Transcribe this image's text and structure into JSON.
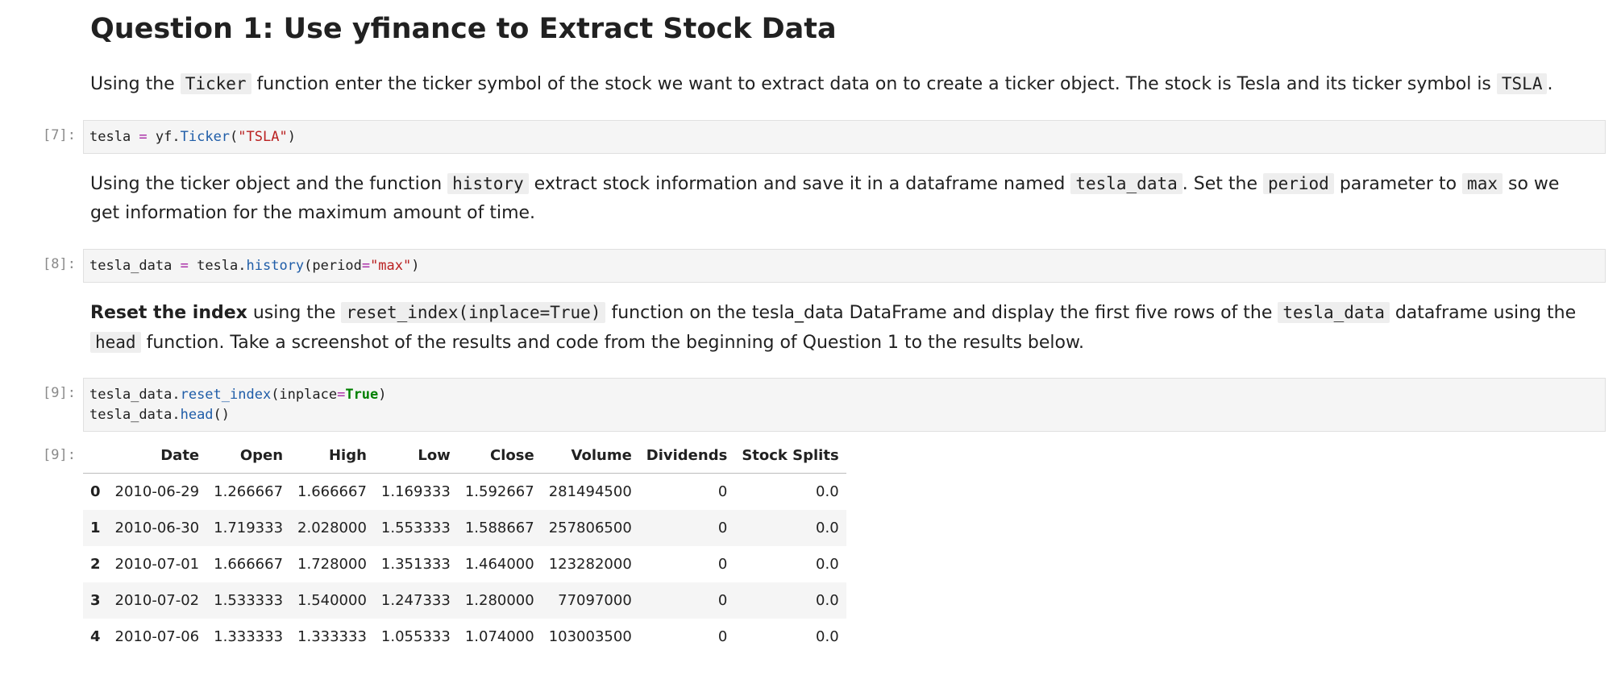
{
  "heading": "Question 1: Use yfinance to Extract Stock Data",
  "para1": {
    "t1": "Using the ",
    "c1": "Ticker",
    "t2": " function enter the ticker symbol of the stock we want to extract data on to create a ticker object. The stock is Tesla and its ticker symbol is ",
    "c2": "TSLA",
    "t3": "."
  },
  "cell7": {
    "prompt": "[7]:",
    "v1": "tesla ",
    "op": "=",
    "v2": " yf.",
    "fn": "Ticker",
    "p1": "(",
    "str": "\"TSLA\"",
    "p2": ")"
  },
  "para2": {
    "t1": "Using the ticker object and the function ",
    "c1": "history",
    "t2": " extract stock information and save it in a dataframe named ",
    "c2": "tesla_data",
    "t3": ". Set the ",
    "c3": "period",
    "t4": " parameter to ",
    "c4": "max",
    "t5": " so we get information for the maximum amount of time."
  },
  "cell8": {
    "prompt": "[8]:",
    "v1": "tesla_data ",
    "op": "=",
    "v2": " tesla.",
    "fn": "history",
    "p1": "(period",
    "op2": "=",
    "str": "\"max\"",
    "p2": ")"
  },
  "para3": {
    "bold": "Reset the index",
    "t1": " using the ",
    "c1": "reset_index(inplace=True)",
    "t2": " function on the tesla_data DataFrame and display the first five rows of the ",
    "c2": "tesla_data",
    "t3": " dataframe using the ",
    "c3": "head",
    "t4": " function. Take a screenshot of the results and code from the beginning of Question 1 to the results below."
  },
  "cell9": {
    "prompt": "[9]:",
    "l1_v1": "tesla_data.",
    "l1_fn": "reset_index",
    "l1_p1": "(inplace",
    "l1_op": "=",
    "l1_kw": "True",
    "l1_p2": ")",
    "l2_v1": "tesla_data.",
    "l2_fn": "head",
    "l2_p1": "()"
  },
  "output9": {
    "prompt": "[9]:",
    "columns": [
      "",
      "Date",
      "Open",
      "High",
      "Low",
      "Close",
      "Volume",
      "Dividends",
      "Stock Splits"
    ],
    "rows": [
      [
        "0",
        "2010-06-29",
        "1.266667",
        "1.666667",
        "1.169333",
        "1.592667",
        "281494500",
        "0",
        "0.0"
      ],
      [
        "1",
        "2010-06-30",
        "1.719333",
        "2.028000",
        "1.553333",
        "1.588667",
        "257806500",
        "0",
        "0.0"
      ],
      [
        "2",
        "2010-07-01",
        "1.666667",
        "1.728000",
        "1.351333",
        "1.464000",
        "123282000",
        "0",
        "0.0"
      ],
      [
        "3",
        "2010-07-02",
        "1.533333",
        "1.540000",
        "1.247333",
        "1.280000",
        "77097000",
        "0",
        "0.0"
      ],
      [
        "4",
        "2010-07-06",
        "1.333333",
        "1.333333",
        "1.055333",
        "1.074000",
        "103003500",
        "0",
        "0.0"
      ]
    ]
  }
}
